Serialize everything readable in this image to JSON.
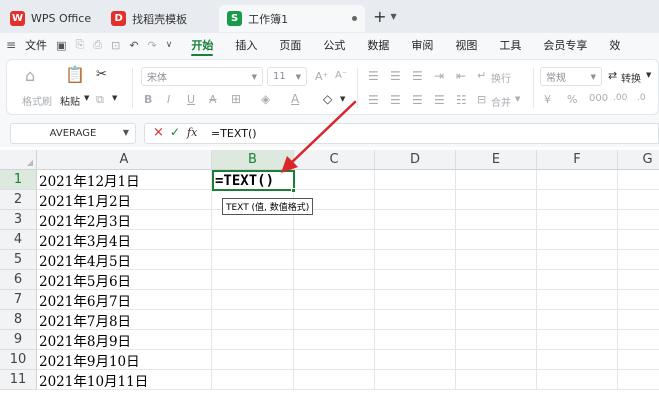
{
  "tabs": [
    {
      "label": "WPS Office",
      "icon": "wps-logo-icon",
      "color": "#e0312d"
    },
    {
      "label": "找稻壳模板",
      "icon": "docer-icon",
      "color": "#e0312d"
    },
    {
      "label": "工作簿1",
      "icon": "spreadsheet-s-icon",
      "icon_letter": "S",
      "color": "#1a9b4b"
    }
  ],
  "menu": {
    "file": "文件",
    "items": [
      "开始",
      "插入",
      "页面",
      "公式",
      "数据",
      "审阅",
      "视图",
      "工具",
      "会员专享",
      "效"
    ],
    "active": "开始"
  },
  "ribbon": {
    "format_painter": "格式刷",
    "paste": "粘贴",
    "font_name": "宋体",
    "font_size": "11",
    "wrap_text": "换行",
    "merge": "合并",
    "number_format": "常规",
    "convert": "转换"
  },
  "formula_bar": {
    "name_box": "AVERAGE",
    "fx": "fx",
    "formula": "=TEXT()"
  },
  "sheet": {
    "columns": [
      "A",
      "B",
      "C",
      "D",
      "E",
      "F",
      "G"
    ],
    "selected_column": "B",
    "rows": [
      "1",
      "2",
      "3",
      "4",
      "5",
      "6",
      "7",
      "8",
      "9",
      "10",
      "11"
    ],
    "selected_row": "1",
    "col_a": [
      "2021年12月1日",
      "2021年1月2日",
      "2021年2月3日",
      "2021年3月4日",
      "2021年4月5日",
      "2021年5月6日",
      "2021年6月7日",
      "2021年7月8日",
      "2021年8月9日",
      "2021年9月10日",
      "2021年10月11日"
    ],
    "active_cell_value": "=TEXT()",
    "tooltip": "TEXT (值, 数值格式)"
  },
  "colors": {
    "accent": "#1a7f37",
    "arrow": "#d9262c"
  }
}
